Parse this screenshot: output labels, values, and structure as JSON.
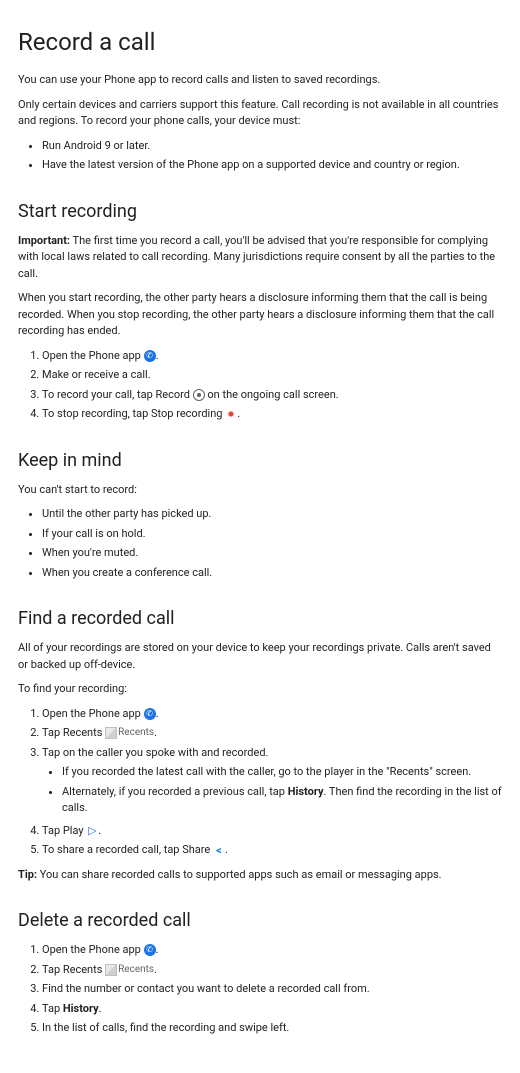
{
  "title": "Record a call",
  "intro1": "You can use your Phone app to record calls and listen to saved recordings.",
  "intro2": "Only certain devices and carriers support this feature. Call recording is not available in all countries and regions. To record your phone calls, your device must:",
  "requirements": [
    "Run Android 9 or later.",
    "Have the latest version of the Phone app on a supported device and country or region."
  ],
  "start": {
    "heading": "Start recording",
    "important_label": "Important:",
    "important_text": " The first time you record a call, you'll be advised that you're responsible for complying with local laws related to call recording. Many jurisdictions require consent by all the parties to the call.",
    "disclosure": "When you start recording, the other party hears a disclosure informing them that the call is being recorded. When you stop recording, the other party hears a disclosure informing them that the call recording has ended.",
    "step1_a": "Open the Phone app ",
    "step2": "Make or receive a call.",
    "step3_a": "To record your call, tap Record ",
    "step3_b": " on the ongoing call screen.",
    "step4_a": "To stop recording, tap Stop recording "
  },
  "keep": {
    "heading": "Keep in mind",
    "lead": "You can't start to record:",
    "items": [
      "Until the other party has picked up.",
      "If your call is on hold.",
      "When you're muted.",
      "When you create a conference call."
    ]
  },
  "find": {
    "heading": "Find a recorded call",
    "intro": "All of your recordings are stored on your device to keep your recordings private. Calls aren't saved or backed up off-device.",
    "lead": "To find your recording:",
    "step1_a": "Open the Phone app ",
    "step2_a": "Tap Recents ",
    "step3": "Tap on the caller you spoke with and recorded.",
    "step3_sub1": "If you recorded the latest call with the caller, go to the player in the \"Recents\" screen.",
    "step3_sub2_a": "Alternately, if you recorded a previous call, tap ",
    "step3_sub2_b": "History",
    "step3_sub2_c": ". Then find the recording in the list of calls.",
    "step4_a": "Tap Play ",
    "step5_a": "To share a recorded call, tap Share ",
    "tip_label": "Tip:",
    "tip_text": " You can share recorded calls to supported apps such as email or messaging apps."
  },
  "delete": {
    "heading": "Delete a recorded call",
    "step1_a": "Open the Phone app ",
    "step2_a": "Tap Recents ",
    "step3": "Find the number or contact you want to delete a recorded call from.",
    "step4_a": "Tap ",
    "step4_b": "History",
    "step5": "In the list of calls, find the recording and swipe left."
  },
  "icons": {
    "recents_alt": "Recents"
  },
  "punct": {
    "period": "."
  }
}
